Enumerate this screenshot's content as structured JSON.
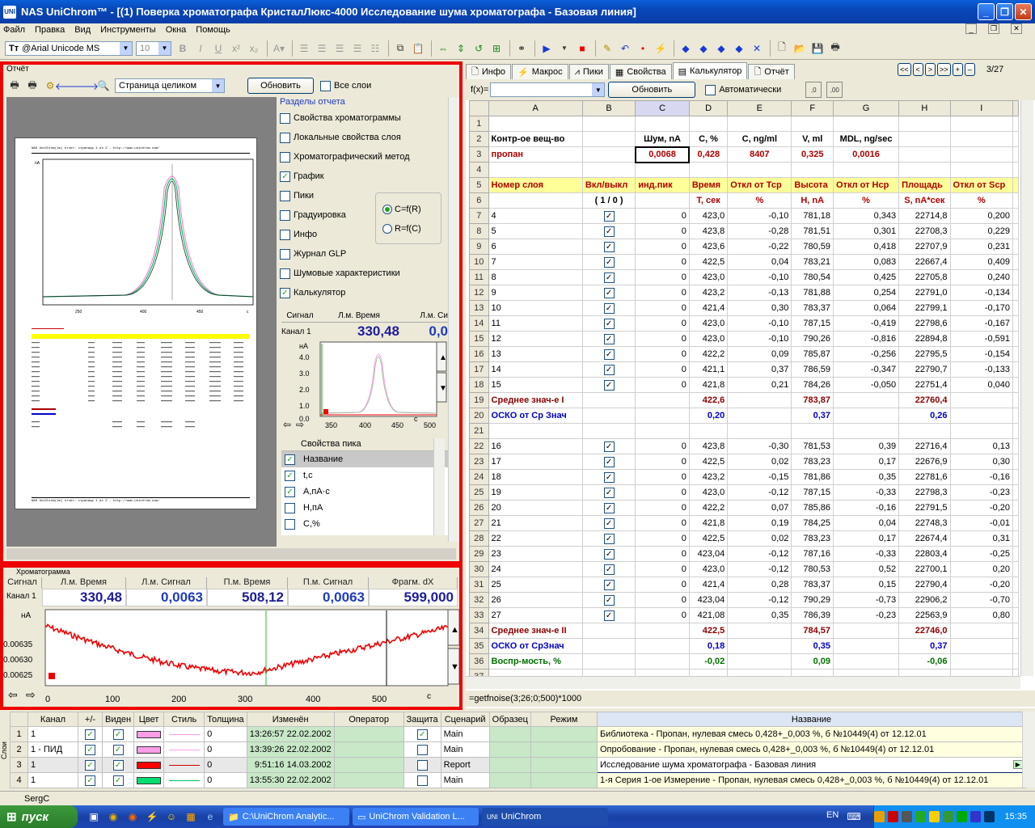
{
  "window": {
    "title": "NAS UniChrom™ - [(1) Поверка хроматографа КристалЛюкс-4000 Исследование шума хроматографа - Базовая линия]",
    "app_icon": "UNI"
  },
  "menu": [
    "Файл",
    "Правка",
    "Вид",
    "Инструменты",
    "Окна",
    "Помощь"
  ],
  "toolbar": {
    "font_name": "@Arial Unicode MS",
    "font_size": "10"
  },
  "report": {
    "panel_title": "Отчёт",
    "page_mode": "Страница целиком",
    "refresh_label": "Обновить",
    "all_layers_label": "Все слои",
    "sections_title": "Разделы отчета",
    "sections": [
      {
        "label": "Свойства хроматограммы",
        "checked": false
      },
      {
        "label": "Локальные свойства слоя",
        "checked": false
      },
      {
        "label": "Хроматографический метод",
        "checked": false
      },
      {
        "label": "График",
        "checked": true
      },
      {
        "label": "Пики",
        "checked": false
      },
      {
        "label": "Градуировка",
        "checked": false
      },
      {
        "label": "Инфо",
        "checked": false
      },
      {
        "label": "Журнал GLP",
        "checked": false
      },
      {
        "label": "Шумовые характеристики",
        "checked": false
      },
      {
        "label": "Калькулятор",
        "checked": true
      }
    ],
    "radio": [
      {
        "label": "C=f(R)",
        "on": true
      },
      {
        "label": "R=f(C)",
        "on": false
      }
    ],
    "page_header": "NAS UniChrom(tm) отчет: страница 1 из 2 - http://www.unichrom.com/",
    "page_footer": "NAS UniChrom(tm) отчет: страница 1 из 2 - http://www.unichrom.com/",
    "mini": {
      "h_signal": "Сигнал",
      "h_time": "Л.м. Время",
      "h_sig2": "Л.м. Си",
      "channel": "Канал 1",
      "time_value": "330,48",
      "sig_value": "0,0",
      "y_unit": "нА",
      "y_ticks": [
        "4.0",
        "3.0",
        "2.0",
        "1.0",
        "0.0"
      ],
      "x_ticks": [
        "350",
        "400",
        "450",
        "500"
      ],
      "x_unit": "c"
    },
    "props_title": "Свойства пика",
    "props": [
      {
        "label": "Название",
        "checked": true
      },
      {
        "label": "t,c",
        "checked": true
      },
      {
        "label": "A,пА·с",
        "checked": true
      },
      {
        "label": "H,пА",
        "checked": false
      },
      {
        "label": "C,%",
        "checked": false
      }
    ]
  },
  "chromatogram": {
    "title": "Хроматограмма",
    "headers": [
      "Сигнал",
      "Л.м. Время",
      "Л.м. Сигнал",
      "П.м. Время",
      "П.м. Сигнал",
      "Фрагм. dX"
    ],
    "channel": "Канал 1",
    "values": [
      "330,48",
      "0,0063",
      "508,12",
      "0,0063",
      "599,000"
    ],
    "y_unit": "нА",
    "y_ticks": [
      "0.00635",
      "0.00630",
      "0.00625"
    ],
    "x_ticks": [
      "0",
      "100",
      "200",
      "300",
      "400",
      "500"
    ],
    "x_unit": "c"
  },
  "tabs": [
    {
      "label": "Инфо",
      "icon": "info-icon",
      "active": false
    },
    {
      "label": "Макрос",
      "icon": "macro-icon",
      "active": false
    },
    {
      "label": "Пики",
      "icon": "peaks-icon",
      "active": false
    },
    {
      "label": "Свойства",
      "icon": "properties-icon",
      "active": false
    },
    {
      "label": "Калькулятор",
      "icon": "calculator-icon",
      "active": true
    },
    {
      "label": "Отчёт",
      "icon": "report-icon",
      "active": false
    }
  ],
  "page_counter": "3/27",
  "fx": {
    "label": "f(x)=",
    "refresh": "Обновить",
    "auto": "Автоматически"
  },
  "sheet": {
    "columns": [
      "A",
      "B",
      "C",
      "D",
      "E",
      "F",
      "G",
      "H",
      "I"
    ],
    "rows": [
      {
        "n": "1",
        "cells": [
          "",
          "",
          "",
          "",
          "",
          "",
          "",
          "",
          ""
        ]
      },
      {
        "n": "2",
        "cells": [
          "Контр-ое вещ-во",
          "",
          "Шум, nA",
          "C, %",
          "C, ng/ml",
          "V, ml",
          "MDL, ng/sec",
          "",
          ""
        ],
        "style": "hdr2"
      },
      {
        "n": "3",
        "cells": [
          "пропан",
          "",
          "0,0068",
          "0,428",
          "8407",
          "0,325",
          "0,0016",
          "",
          ""
        ],
        "style": "row3"
      },
      {
        "n": "4",
        "cells": [
          "",
          "",
          "",
          "",
          "",
          "",
          "",
          "",
          ""
        ]
      },
      {
        "n": "5",
        "cells": [
          "Номер слоя",
          "Вкл/выкл",
          "инд.пик",
          "Время",
          "Откл от Тср",
          "Высота",
          "Откл от Нср",
          "Площадь",
          "Откл от Sср"
        ],
        "style": "yel"
      },
      {
        "n": "6",
        "cells": [
          "",
          "( 1 / 0 )",
          "",
          "T, сек",
          "%",
          "H, nA",
          "%",
          "S, nA*сек",
          "%"
        ],
        "style": "units"
      },
      {
        "n": "7",
        "cells": [
          "4",
          "✓",
          "0",
          "423,0",
          "-0,10",
          "781,18",
          "0,343",
          "22714,8",
          "0,200"
        ]
      },
      {
        "n": "8",
        "cells": [
          "5",
          "✓",
          "0",
          "423,8",
          "-0,28",
          "781,51",
          "0,301",
          "22708,3",
          "0,229"
        ]
      },
      {
        "n": "9",
        "cells": [
          "6",
          "✓",
          "0",
          "423,6",
          "-0,22",
          "780,59",
          "0,418",
          "22707,9",
          "0,231"
        ]
      },
      {
        "n": "10",
        "cells": [
          "7",
          "✓",
          "0",
          "422,5",
          "0,04",
          "783,21",
          "0,083",
          "22667,4",
          "0,409"
        ]
      },
      {
        "n": "11",
        "cells": [
          "8",
          "✓",
          "0",
          "423,0",
          "-0,10",
          "780,54",
          "0,425",
          "22705,8",
          "0,240"
        ]
      },
      {
        "n": "12",
        "cells": [
          "9",
          "✓",
          "0",
          "423,2",
          "-0,13",
          "781,88",
          "0,254",
          "22791,0",
          "-0,134"
        ]
      },
      {
        "n": "13",
        "cells": [
          "10",
          "✓",
          "0",
          "421,4",
          "0,30",
          "783,37",
          "0,064",
          "22799,1",
          "-0,170"
        ]
      },
      {
        "n": "14",
        "cells": [
          "11",
          "✓",
          "0",
          "423,0",
          "-0,10",
          "787,15",
          "-0,419",
          "22798,6",
          "-0,167"
        ]
      },
      {
        "n": "15",
        "cells": [
          "12",
          "✓",
          "0",
          "423,0",
          "-0,10",
          "790,26",
          "-0,816",
          "22894,8",
          "-0,591"
        ]
      },
      {
        "n": "16",
        "cells": [
          "13",
          "✓",
          "0",
          "422,2",
          "0,09",
          "785,87",
          "-0,256",
          "22795,5",
          "-0,154"
        ]
      },
      {
        "n": "17",
        "cells": [
          "14",
          "✓",
          "0",
          "421,1",
          "0,37",
          "786,59",
          "-0,347",
          "22790,7",
          "-0,133"
        ]
      },
      {
        "n": "18",
        "cells": [
          "15",
          "✓",
          "0",
          "421,8",
          "0,21",
          "784,26",
          "-0,050",
          "22751,4",
          "0,040"
        ]
      },
      {
        "n": "19",
        "cells": [
          "Среднее знач-е I",
          "",
          "",
          "422,6",
          "",
          "783,87",
          "",
          "22760,4",
          ""
        ],
        "style": "maroon"
      },
      {
        "n": "20",
        "cells": [
          "ОСКО от Ср Знач",
          "",
          "",
          "0,20",
          "",
          "0,37",
          "",
          "0,26",
          ""
        ],
        "style": "navy"
      },
      {
        "n": "21",
        "cells": [
          "",
          "",
          "",
          "",
          "",
          "",
          "",
          "",
          ""
        ]
      },
      {
        "n": "22",
        "cells": [
          "16",
          "✓",
          "0",
          "423,8",
          "-0,30",
          "781,53",
          "0,39",
          "22716,4",
          "0,13"
        ]
      },
      {
        "n": "23",
        "cells": [
          "17",
          "✓",
          "0",
          "422,5",
          "0,02",
          "783,23",
          "0,17",
          "22676,9",
          "0,30"
        ]
      },
      {
        "n": "24",
        "cells": [
          "18",
          "✓",
          "0",
          "423,2",
          "-0,15",
          "781,86",
          "0,35",
          "22781,6",
          "-0,16"
        ]
      },
      {
        "n": "25",
        "cells": [
          "19",
          "✓",
          "0",
          "423,0",
          "-0,12",
          "787,15",
          "-0,33",
          "22798,3",
          "-0,23"
        ]
      },
      {
        "n": "26",
        "cells": [
          "20",
          "✓",
          "0",
          "422,2",
          "0,07",
          "785,86",
          "-0,16",
          "22791,5",
          "-0,20"
        ]
      },
      {
        "n": "27",
        "cells": [
          "21",
          "✓",
          "0",
          "421,8",
          "0,19",
          "784,25",
          "0,04",
          "22748,3",
          "-0,01"
        ]
      },
      {
        "n": "28",
        "cells": [
          "22",
          "✓",
          "0",
          "422,5",
          "0,02",
          "783,23",
          "0,17",
          "22674,4",
          "0,31"
        ]
      },
      {
        "n": "29",
        "cells": [
          "23",
          "✓",
          "0",
          "423,04",
          "-0,12",
          "787,16",
          "-0,33",
          "22803,4",
          "-0,25"
        ]
      },
      {
        "n": "30",
        "cells": [
          "24",
          "✓",
          "0",
          "423,0",
          "-0,12",
          "780,53",
          "0,52",
          "22700,1",
          "0,20"
        ]
      },
      {
        "n": "31",
        "cells": [
          "25",
          "✓",
          "0",
          "421,4",
          "0,28",
          "783,37",
          "0,15",
          "22790,4",
          "-0,20"
        ]
      },
      {
        "n": "32",
        "cells": [
          "26",
          "✓",
          "0",
          "423,04",
          "-0,12",
          "790,29",
          "-0,73",
          "22906,2",
          "-0,70"
        ]
      },
      {
        "n": "33",
        "cells": [
          "27",
          "✓",
          "0",
          "421,08",
          "0,35",
          "786,39",
          "-0,23",
          "22563,9",
          "0,80"
        ]
      },
      {
        "n": "34",
        "cells": [
          "Среднее знач-е  II",
          "",
          "",
          "422,5",
          "",
          "784,57",
          "",
          "22746,0",
          ""
        ],
        "style": "maroon"
      },
      {
        "n": "35",
        "cells": [
          "ОСКО от СрЗнач",
          "",
          "",
          "0,18",
          "",
          "0,35",
          "",
          "0,37",
          ""
        ],
        "style": "navy"
      },
      {
        "n": "36",
        "cells": [
          "Воспр-мость, %",
          "",
          "",
          "-0,02",
          "",
          "0,09",
          "",
          "-0,06",
          ""
        ],
        "style": "green"
      },
      {
        "n": "37",
        "cells": [
          "",
          "",
          "",
          "",
          "",
          "",
          "",
          "",
          ""
        ]
      }
    ]
  },
  "formula": "=getfnoise(3;26;0;500)*1000",
  "layers": {
    "side_label": "Слои",
    "headers": [
      "Канал",
      "+/-",
      "Виден",
      "Цвет",
      "Стиль",
      "Толщина",
      "Изменён",
      "Оператор",
      "Защита",
      "Сценарий",
      "Образец",
      "Режим",
      "Название"
    ],
    "rows": [
      {
        "n": "1",
        "channel": "1",
        "plus": true,
        "visible": true,
        "color": "#ff9ee8",
        "line": "#ff9ee8",
        "width": "0",
        "changed": "13:26:57 22.02.2002",
        "protect": true,
        "scenario": "Main",
        "name": "Библиотека - Пропан, нулевая смесь 0,428+_0,003 %, б №10449(4) от 12.12.01"
      },
      {
        "n": "2",
        "channel": "1 - ПИД",
        "plus": true,
        "visible": true,
        "color": "#ff9ee8",
        "line": "#ff9ee8",
        "width": "0",
        "changed": "13:39:26 22.02.2002",
        "protect": false,
        "scenario": "Main",
        "name": "Опробование - Пропан, нулевая смесь 0,428+_0,003 %, б №10449(4) от 12.12.01"
      },
      {
        "n": "3",
        "channel": "1",
        "plus": true,
        "visible": true,
        "color": "#ff0000",
        "line": "#d00000",
        "width": "0",
        "changed": "9:51:16 14.03.2002",
        "protect": false,
        "scenario": "Report",
        "name": "Исследование шума хроматографа - Базовая линия"
      },
      {
        "n": "4",
        "channel": "1",
        "plus": true,
        "visible": true,
        "color": "#00e070",
        "line": "#00c060",
        "width": "0",
        "changed": "13:55:30 22.02.2002",
        "protect": false,
        "scenario": "Main",
        "name": "1-я Серия 1-ое Измерение - Пропан, нулевая смесь 0,428+_0,003 %, б №10449(4) от 12.12.01"
      }
    ]
  },
  "status": {
    "user": "SergC"
  },
  "taskbar": {
    "start": "пуск",
    "tasks": [
      {
        "label": "C:\\UniChrom Analytic...",
        "active": false
      },
      {
        "label": "UniChrom Validation L...",
        "active": false
      },
      {
        "label": "UniChrom",
        "active": true
      }
    ],
    "lang": "EN",
    "clock": "15:35"
  },
  "colors": {
    "accent_red": "#e00000",
    "title_blue": "#0a47b8",
    "sheet_yellow": "#ffff9a"
  }
}
